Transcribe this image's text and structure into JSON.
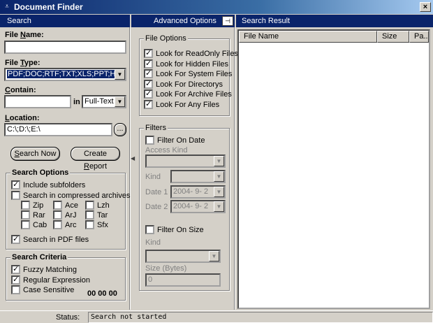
{
  "window": {
    "title": "Document Finder",
    "close_glyph": "×"
  },
  "panels": {
    "search_title": "Search",
    "advanced_title": "Advanced Options",
    "result_title": "Search Result",
    "pin_glyph": "⊣"
  },
  "search": {
    "file_name_label_pre": "File ",
    "file_name_label_u": "N",
    "file_name_label_post": "ame:",
    "file_name_value": "",
    "file_type_label_pre": "File ",
    "file_type_label_u": "T",
    "file_type_label_post": "ype:",
    "file_type_value": "PDF;DOC;RTF;TXT;XLS;PPT;HTM",
    "contain_label_u": "C",
    "contain_label_post": "ontain:",
    "contain_value": "",
    "in_label": "in",
    "contain_mode": "Full-Text",
    "location_label_u": "L",
    "location_label_post": "ocation:",
    "location_value": "C:\\;D:\\;E:\\",
    "browse_label": "...",
    "search_now_pre": "",
    "search_now_u": "S",
    "search_now_post": "earch Now",
    "create_report_pre": "Create ",
    "create_report_u": "R",
    "create_report_post": "eport"
  },
  "search_options": {
    "title": "Search Options",
    "include_subfolders": "Include subfolders",
    "compressed": "Search in compressed archives",
    "archives": [
      "Zip",
      "Ace",
      "Lzh",
      "Rar",
      "ArJ",
      "Tar",
      "Cab",
      "Arc",
      "Sfx"
    ],
    "pdf": "Search in PDF files"
  },
  "search_criteria": {
    "title": "Search Criteria",
    "fuzzy": "Fuzzy Matching",
    "regex": "Regular Expression",
    "case": "Case Sensitive",
    "counter": "00 00 00"
  },
  "file_options": {
    "title": "File Options",
    "items": [
      "Look for ReadOnly Files",
      "Look for Hidden Files",
      "Look For System Files",
      "Look For Directorys",
      "Look For Archive Files",
      "Look For Any Files"
    ]
  },
  "filters": {
    "title": "Filters",
    "filter_on_date": "Filter On Date",
    "access_kind": "Access Kind",
    "kind": "Kind",
    "date1": "Date 1",
    "date1_value": "2004-  9-  2",
    "date2": "Date 2",
    "date2_value": "2004-  9-  2",
    "filter_on_size": "Filter On Size",
    "size_kind": "Kind",
    "size_bytes": "Size (Bytes)",
    "size_value": "0"
  },
  "result": {
    "columns": [
      "File Name",
      "Size",
      "Pa..."
    ]
  },
  "status": {
    "label": "Status:",
    "value": "Search not started"
  }
}
